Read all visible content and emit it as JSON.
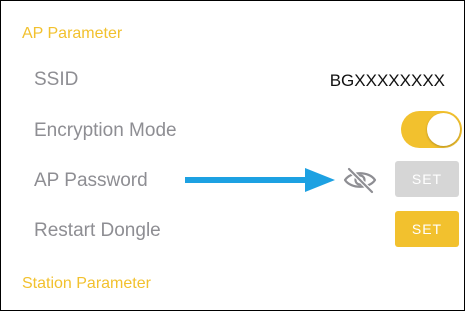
{
  "ap_section": {
    "header": "AP Parameter",
    "ssid_label": "SSID",
    "ssid_value": "BGXXXXXXXX",
    "encryption_label": "Encryption Mode",
    "encryption_enabled": true,
    "password_label": "AP Password",
    "password_set_label": "SET",
    "restart_label": "Restart Dongle",
    "restart_set_label": "SET"
  },
  "station_section": {
    "header": "Station Parameter"
  },
  "icons": {
    "password_visibility": "eye-slash-icon",
    "annotation": "right-arrow-icon"
  },
  "colors": {
    "accent": "#f2c12e",
    "disabled_button": "#d6d6d6",
    "label_gray": "#8e8e93",
    "annotation_arrow": "#1da1e2"
  }
}
